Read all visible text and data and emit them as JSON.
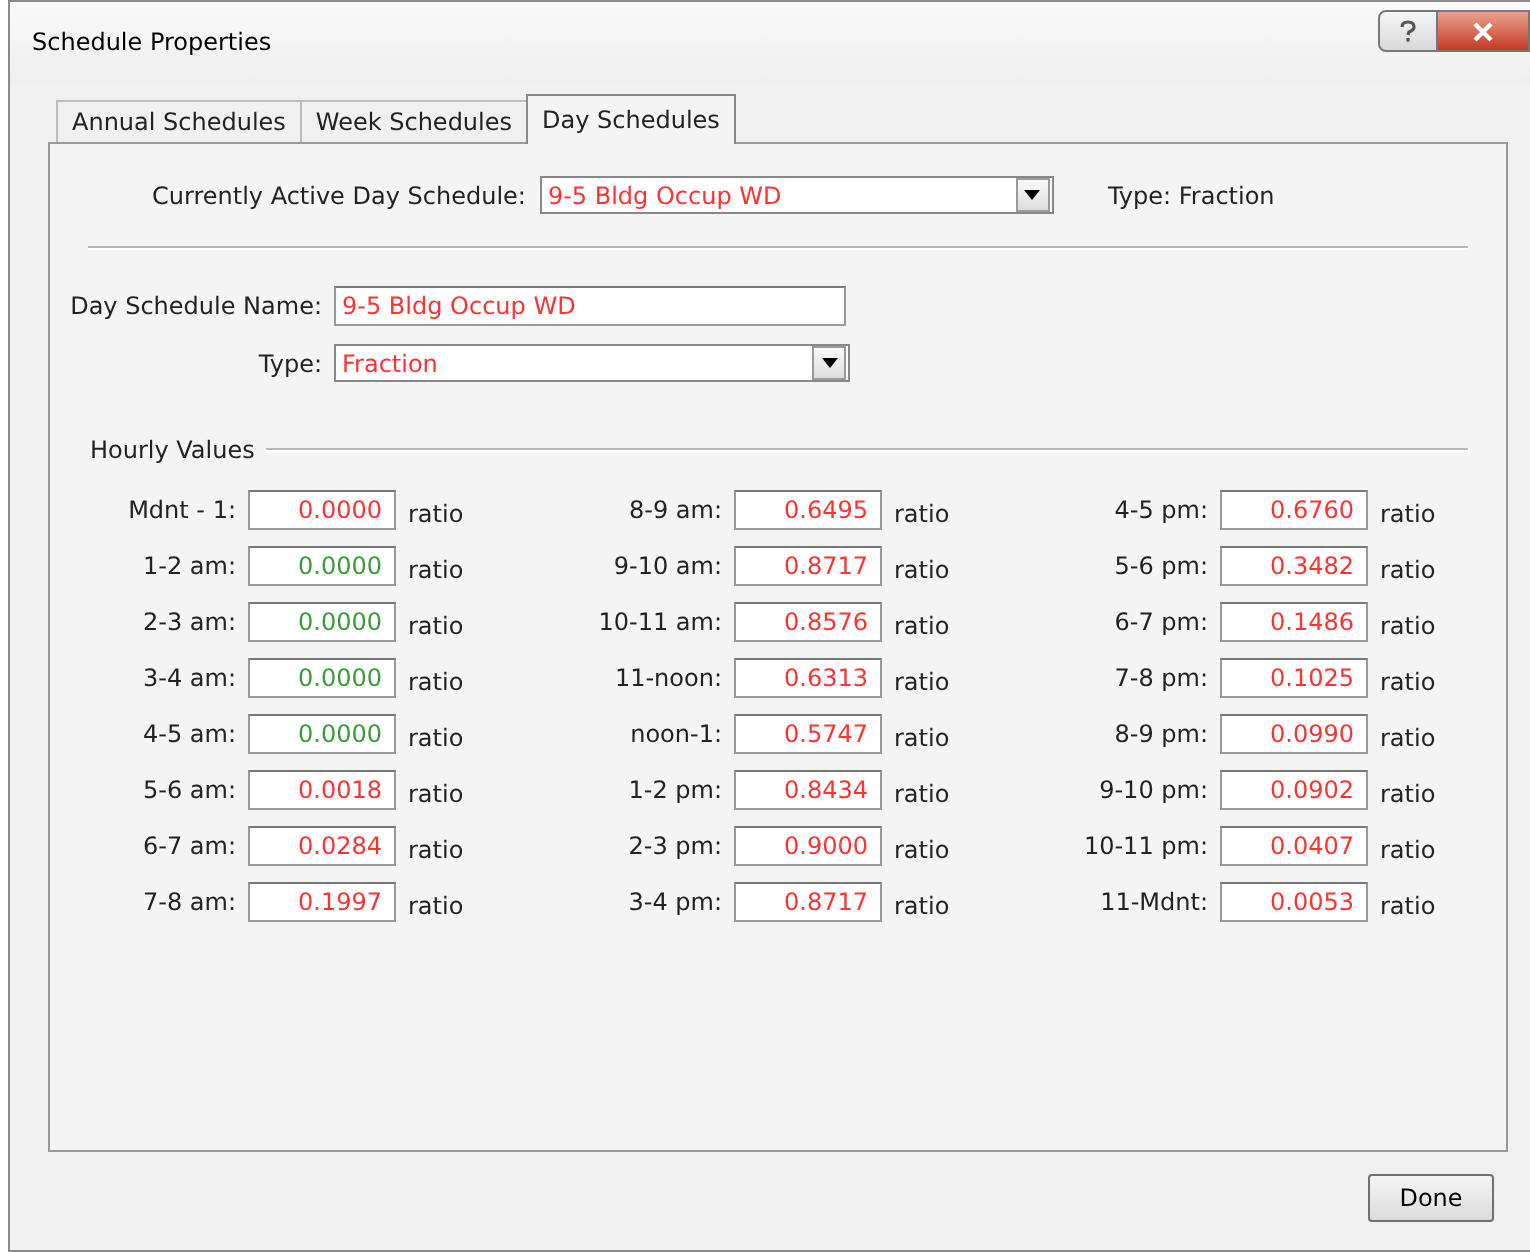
{
  "window": {
    "title": "Schedule Properties"
  },
  "tabs": [
    {
      "label": "Annual Schedules",
      "selected": false
    },
    {
      "label": "Week Schedules",
      "selected": false
    },
    {
      "label": "Day Schedules",
      "selected": true
    }
  ],
  "active_schedule": {
    "label": "Currently Active Day Schedule:",
    "value": "9-5 Bldg Occup WD",
    "type_text": "Type: Fraction"
  },
  "day_schedule_name": {
    "label": "Day Schedule Name:",
    "value": "9-5 Bldg Occup WD"
  },
  "type": {
    "label": "Type:",
    "value": "Fraction"
  },
  "hourly_values": {
    "title": "Hourly Values",
    "rows": [
      {
        "label": "Mdnt - 1:",
        "value": "0.0000",
        "unit": "ratio",
        "color": "#ff3333"
      },
      {
        "label": "1-2 am:",
        "value": "0.0000",
        "unit": "ratio",
        "color": "#3a9a3a"
      },
      {
        "label": "2-3 am:",
        "value": "0.0000",
        "unit": "ratio",
        "color": "#3a9a3a"
      },
      {
        "label": "3-4 am:",
        "value": "0.0000",
        "unit": "ratio",
        "color": "#3a9a3a"
      },
      {
        "label": "4-5 am:",
        "value": "0.0000",
        "unit": "ratio",
        "color": "#3a9a3a"
      },
      {
        "label": "5-6 am:",
        "value": "0.0018",
        "unit": "ratio",
        "color": "#ff3333"
      },
      {
        "label": "6-7 am:",
        "value": "0.0284",
        "unit": "ratio",
        "color": "#ff3333"
      },
      {
        "label": "7-8 am:",
        "value": "0.1997",
        "unit": "ratio",
        "color": "#ff3333"
      },
      {
        "label": "8-9 am:",
        "value": "0.6495",
        "unit": "ratio",
        "color": "#ff3333"
      },
      {
        "label": "9-10 am:",
        "value": "0.8717",
        "unit": "ratio",
        "color": "#ff3333"
      },
      {
        "label": "10-11 am:",
        "value": "0.8576",
        "unit": "ratio",
        "color": "#ff3333"
      },
      {
        "label": "11-noon:",
        "value": "0.6313",
        "unit": "ratio",
        "color": "#ff3333"
      },
      {
        "label": "noon-1:",
        "value": "0.5747",
        "unit": "ratio",
        "color": "#ff3333"
      },
      {
        "label": "1-2 pm:",
        "value": "0.8434",
        "unit": "ratio",
        "color": "#ff3333"
      },
      {
        "label": "2-3 pm:",
        "value": "0.9000",
        "unit": "ratio",
        "color": "#ff3333"
      },
      {
        "label": "3-4 pm:",
        "value": "0.8717",
        "unit": "ratio",
        "color": "#ff3333"
      },
      {
        "label": "4-5 pm:",
        "value": "0.6760",
        "unit": "ratio",
        "color": "#ff3333"
      },
      {
        "label": "5-6 pm:",
        "value": "0.3482",
        "unit": "ratio",
        "color": "#ff3333"
      },
      {
        "label": "6-7 pm:",
        "value": "0.1486",
        "unit": "ratio",
        "color": "#ff3333"
      },
      {
        "label": "7-8 pm:",
        "value": "0.1025",
        "unit": "ratio",
        "color": "#ff3333"
      },
      {
        "label": "8-9 pm:",
        "value": "0.0990",
        "unit": "ratio",
        "color": "#ff3333"
      },
      {
        "label": "9-10 pm:",
        "value": "0.0902",
        "unit": "ratio",
        "color": "#ff3333"
      },
      {
        "label": "10-11 pm:",
        "value": "0.0407",
        "unit": "ratio",
        "color": "#ff3333"
      },
      {
        "label": "11-Mdnt:",
        "value": "0.0053",
        "unit": "ratio",
        "color": "#ff3333"
      }
    ]
  },
  "buttons": [
    {
      "label": "Done"
    }
  ]
}
